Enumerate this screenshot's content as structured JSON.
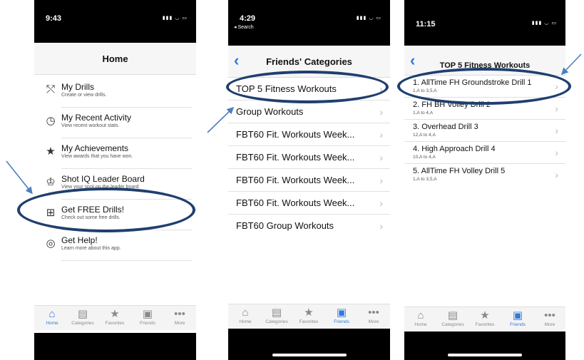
{
  "phones": [
    {
      "status": {
        "time": "9:43",
        "icons": "▮▮▮ ◡ ▭"
      },
      "header": {
        "title": "Home"
      },
      "menu": [
        {
          "title": "My Drills",
          "subtitle": "Create or view drills.",
          "icon": "drills-icon"
        },
        {
          "title": "My Recent Activity",
          "subtitle": "View recent workout stats.",
          "icon": "clock-icon"
        },
        {
          "title": "My Achievements",
          "subtitle": "View awards that you have won.",
          "icon": "achievement-icon"
        },
        {
          "title": "Shot IQ Leader Board",
          "subtitle": "View your spot on the leader board.",
          "icon": "trophy-icon"
        },
        {
          "title": "Get FREE Drills!",
          "subtitle": "Check out some free drills.",
          "icon": "gift-icon"
        },
        {
          "title": "Get Help!",
          "subtitle": "Learn more about this app.",
          "icon": "lifebuoy-icon"
        }
      ],
      "tabs": [
        {
          "label": "Home",
          "glyph": "⌂",
          "active": true
        },
        {
          "label": "Categories",
          "glyph": "▤",
          "active": false
        },
        {
          "label": "Favorites",
          "glyph": "★",
          "active": false
        },
        {
          "label": "Friends",
          "glyph": "▣",
          "active": false
        },
        {
          "label": "More",
          "glyph": "•••",
          "active": false
        }
      ]
    },
    {
      "status": {
        "time": "4:29",
        "back_label": "◂ Search",
        "icons": "▮▮▮ ◡ ▭"
      },
      "header": {
        "title": "Friends' Categories",
        "back": "‹"
      },
      "rows": [
        "TOP 5 Fitness Workouts",
        "Group Workouts",
        "FBT60 Fit. Workouts Week...",
        "FBT60 Fit. Workouts Week...",
        "FBT60 Fit. Workouts Week...",
        "FBT60 Fit. Workouts Week...",
        "FBT60 Group Workouts"
      ],
      "tabs": [
        {
          "label": "Home",
          "glyph": "⌂",
          "active": false
        },
        {
          "label": "Categories",
          "glyph": "▤",
          "active": false
        },
        {
          "label": "Favorites",
          "glyph": "★",
          "active": false
        },
        {
          "label": "Friends",
          "glyph": "▣",
          "active": true
        },
        {
          "label": "More",
          "glyph": "•••",
          "active": false
        }
      ]
    },
    {
      "status": {
        "time": "11:15",
        "icons": "▮▮▮ ◡ ▭"
      },
      "header": {
        "title": "TOP 5 Fitness Workouts",
        "back": "‹"
      },
      "rows": [
        {
          "title": "1. AllTime FH Groundstroke Drill 1",
          "subtitle": "1,A to 3,5,A"
        },
        {
          "title": "2. FH BH Volley Drill 2",
          "subtitle": "1,A to 4,A"
        },
        {
          "title": "3. Overhead Drill 3",
          "subtitle": "12,A to 4,A"
        },
        {
          "title": "4. High Approach Drill 4",
          "subtitle": "10,A to 4,A"
        },
        {
          "title": "5. AllTime FH Volley Drill 5",
          "subtitle": "1,A to 3,5,A"
        }
      ],
      "tabs": [
        {
          "label": "Home",
          "glyph": "⌂",
          "active": false
        },
        {
          "label": "Categories",
          "glyph": "▤",
          "active": false
        },
        {
          "label": "Favorites",
          "glyph": "★",
          "active": false
        },
        {
          "label": "Friends",
          "glyph": "▣",
          "active": true
        },
        {
          "label": "More",
          "glyph": "•••",
          "active": false
        }
      ]
    }
  ],
  "chevron": "›",
  "colors": {
    "accent": "#2f7ad8",
    "annotation": "#1f3f6e",
    "arrow": "#4d7fbf"
  }
}
